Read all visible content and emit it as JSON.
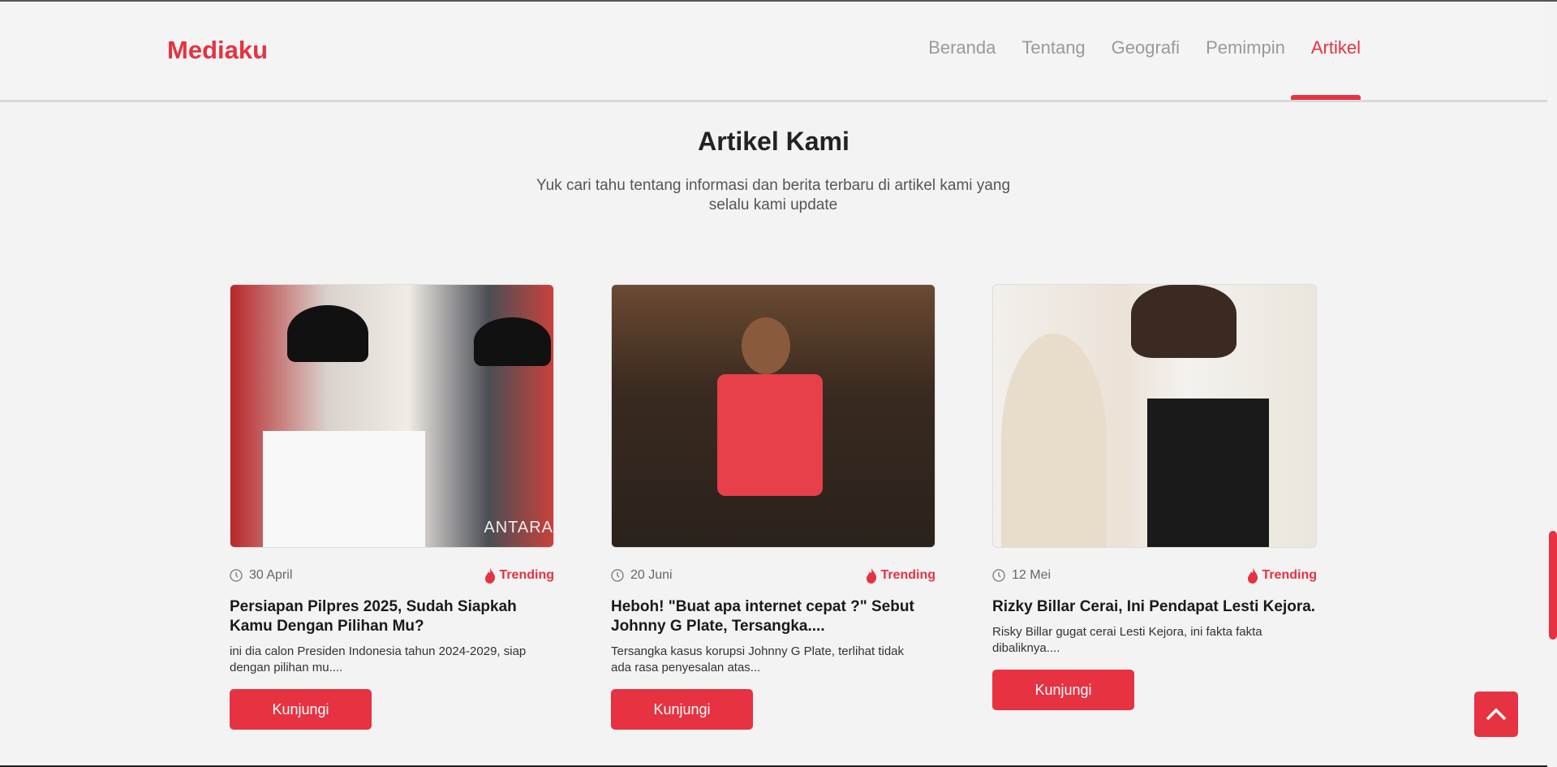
{
  "header": {
    "logo": "Mediaku",
    "nav": [
      {
        "label": "Beranda"
      },
      {
        "label": "Tentang"
      },
      {
        "label": "Geografi"
      },
      {
        "label": "Pemimpin"
      },
      {
        "label": "Artikel",
        "active": true
      }
    ]
  },
  "section": {
    "title": "Artikel Kami",
    "subtitle": "Yuk cari tahu tentang informasi dan berita terbaru di artikel kami yang selalu kami update"
  },
  "articles": [
    {
      "date": "30 April",
      "badge": "Trending",
      "title": "Persiapan Pilpres 2025, Sudah Siapkah Kamu Dengan Pilihan Mu?",
      "desc": "ini dia calon Presiden Indonesia tahun 2024-2029, siap dengan pilihan mu....",
      "button": "Kunjungi",
      "watermark": "ANTARA"
    },
    {
      "date": "20 Juni",
      "badge": "Trending",
      "title": "Heboh! \"Buat apa internet cepat ?\" Sebut Johnny G Plate, Tersangka....",
      "desc": "Tersangka kasus korupsi Johnny G Plate, terlihat tidak ada rasa penyesalan atas...",
      "button": "Kunjungi"
    },
    {
      "date": "12 Mei",
      "badge": "Trending",
      "title": "Rizky Billar Cerai, Ini Pendapat Lesti Kejora.",
      "desc": "Risky Billar gugat cerai Lesti Kejora, ini fakta fakta dibaliknya....",
      "button": "Kunjungi"
    }
  ],
  "colors": {
    "accent": "#e63241"
  }
}
